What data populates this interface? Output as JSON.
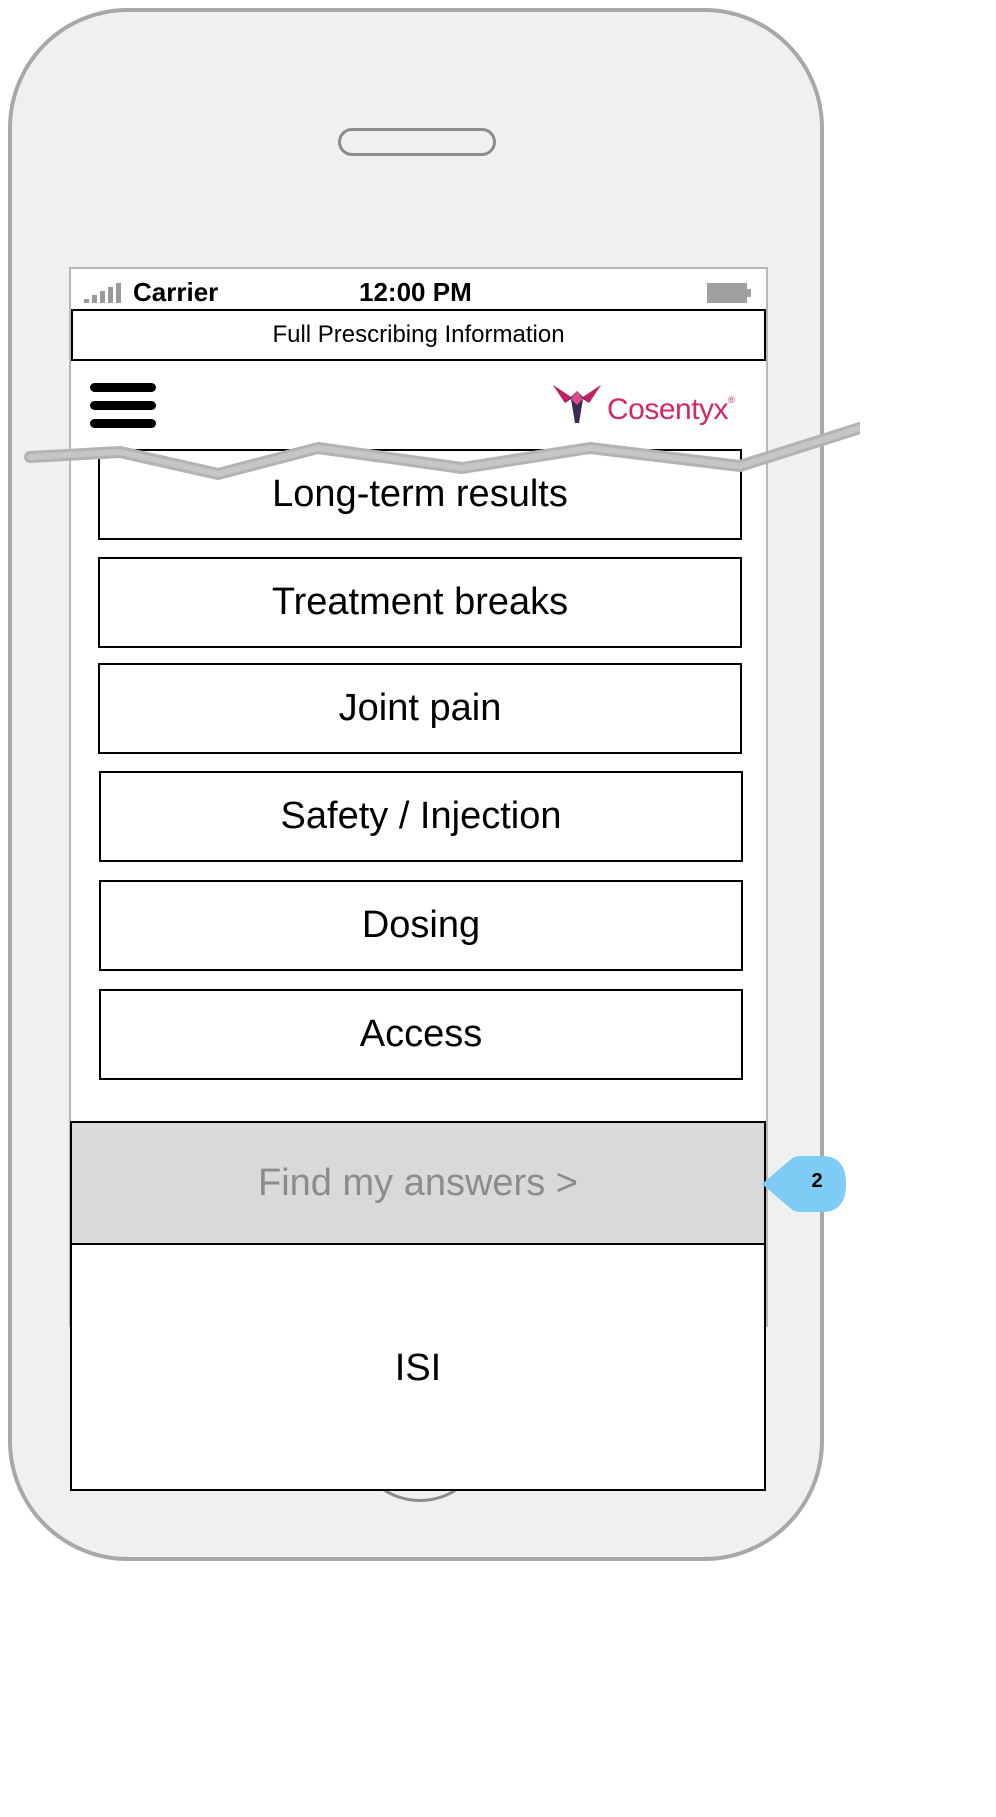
{
  "status_bar": {
    "carrier": "Carrier",
    "time": "12:00 PM"
  },
  "top_link": {
    "label": "Full Prescribing Information"
  },
  "header": {
    "logo_text": "Cosentyx",
    "logo_mark": "®",
    "brand_color": "#d4256e",
    "logo_icon": "cosentyx-logo-icon",
    "menu_icon": "hamburger-menu-icon"
  },
  "menu": {
    "items": [
      {
        "label": "Long-term results"
      },
      {
        "label": "Treatment breaks"
      },
      {
        "label": "Joint pain"
      },
      {
        "label": "Safety / Injection"
      },
      {
        "label": "Dosing"
      },
      {
        "label": "Access"
      }
    ]
  },
  "cta": {
    "label": "Find my answers >",
    "state": "disabled"
  },
  "isi": {
    "label": "ISI"
  },
  "annotation": {
    "number": "2",
    "color": "#7ecbf5"
  }
}
